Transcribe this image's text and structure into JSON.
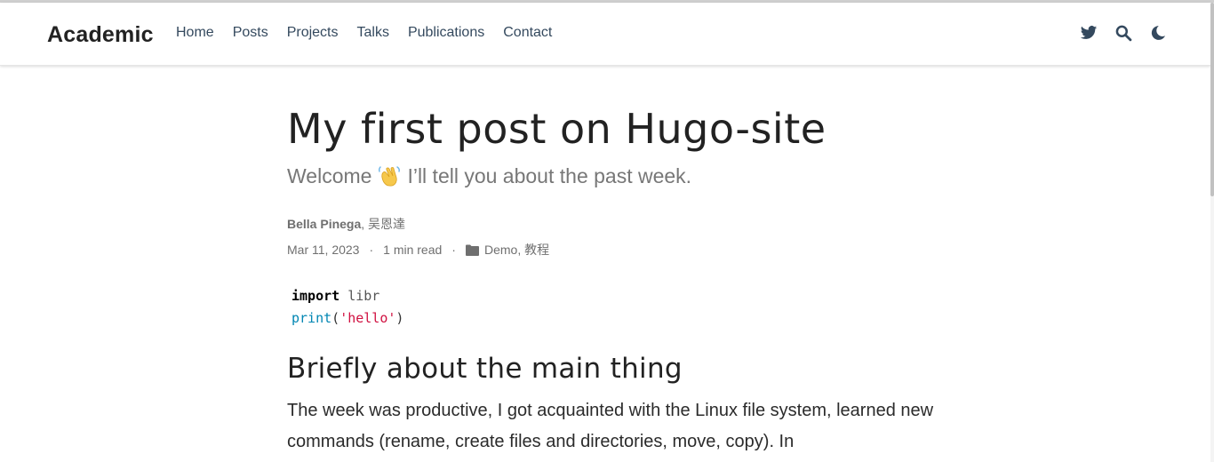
{
  "navbar": {
    "brand": "Academic",
    "links": [
      "Home",
      "Posts",
      "Projects",
      "Talks",
      "Publications",
      "Contact"
    ],
    "icons": [
      "twitter-icon",
      "search-icon",
      "moon-icon"
    ]
  },
  "article": {
    "title": "My first post on Hugo-site",
    "subtitle_before": "Welcome",
    "subtitle_after": "I’ll tell you about the past week.",
    "author_primary": "Bella Pinega",
    "author_secondary": ", 吴恩達",
    "date": "Mar 11, 2023",
    "sep1": "·",
    "read_time": "1 min read",
    "sep2": "·",
    "categories": "Demo, 教程",
    "code": {
      "line1_kw": "import",
      "line1_mod": "libr",
      "line2_fn": "print",
      "line2_open": "(",
      "line2_str": "'hello'",
      "line2_close": ")"
    },
    "heading2": "Briefly about the main thing",
    "paragraph": "The week was productive, I got acquainted with the Linux file system, learned new commands (rename, create files and directories, move, copy). In"
  },
  "colors": {
    "nav_text": "#34495e",
    "twitter": "#34495e",
    "code_string": "#d01040",
    "code_function": "#0086b3"
  }
}
